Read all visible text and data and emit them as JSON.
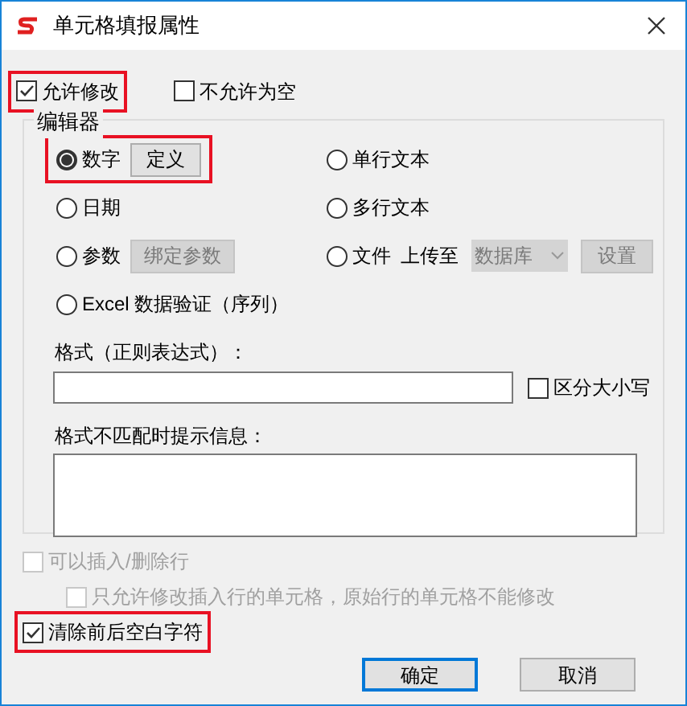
{
  "window": {
    "title": "单元格填报属性"
  },
  "top_options": [
    {
      "label": "允许修改",
      "checked": true,
      "highlighted": true
    },
    {
      "label": "不允许为空",
      "checked": false,
      "highlighted": false
    }
  ],
  "editor": {
    "legend": "编辑器",
    "rows": [
      [
        {
          "kind": "button",
          "label": "数字",
          "selected": true,
          "highlighted": true,
          "button": {
            "label": "定义",
            "disabled": false
          }
        },
        {
          "kind": "plain",
          "label": "单行文本",
          "selected": false,
          "highlighted": false
        }
      ],
      [
        {
          "kind": "plain",
          "label": "日期",
          "selected": false,
          "highlighted": false
        },
        {
          "kind": "plain",
          "label": "多行文本",
          "selected": false,
          "highlighted": false
        }
      ],
      [
        {
          "kind": "button",
          "label": "参数",
          "selected": false,
          "highlighted": false,
          "button": {
            "label": "绑定参数",
            "disabled": true
          }
        },
        {
          "kind": "upload",
          "label": "文件",
          "selected": false,
          "highlighted": false,
          "upload_label": "上传至",
          "dropdown": {
            "value": "数据库",
            "disabled": true
          },
          "button": {
            "label": "设置",
            "disabled": true
          }
        }
      ],
      [
        {
          "kind": "plain",
          "label": "Excel 数据验证（序列）",
          "selected": false,
          "highlighted": false
        }
      ]
    ],
    "format_label": "格式（正则表达式）：",
    "case_sensitive": {
      "label": "区分大小写",
      "checked": false
    },
    "message_label": "格式不匹配时提示信息："
  },
  "bottom_options": [
    {
      "label": "可以插入/删除行",
      "checked": false,
      "disabled": true,
      "highlighted": false,
      "children": [
        {
          "label": "只允许修改插入行的单元格，原始行的单元格不能修改",
          "checked": false,
          "disabled": true,
          "highlighted": false
        }
      ]
    },
    {
      "label": "清除前后空白字符",
      "checked": true,
      "disabled": false,
      "highlighted": true
    }
  ],
  "buttons": [
    {
      "label": "确定",
      "default": true
    },
    {
      "label": "取消",
      "default": false
    }
  ]
}
